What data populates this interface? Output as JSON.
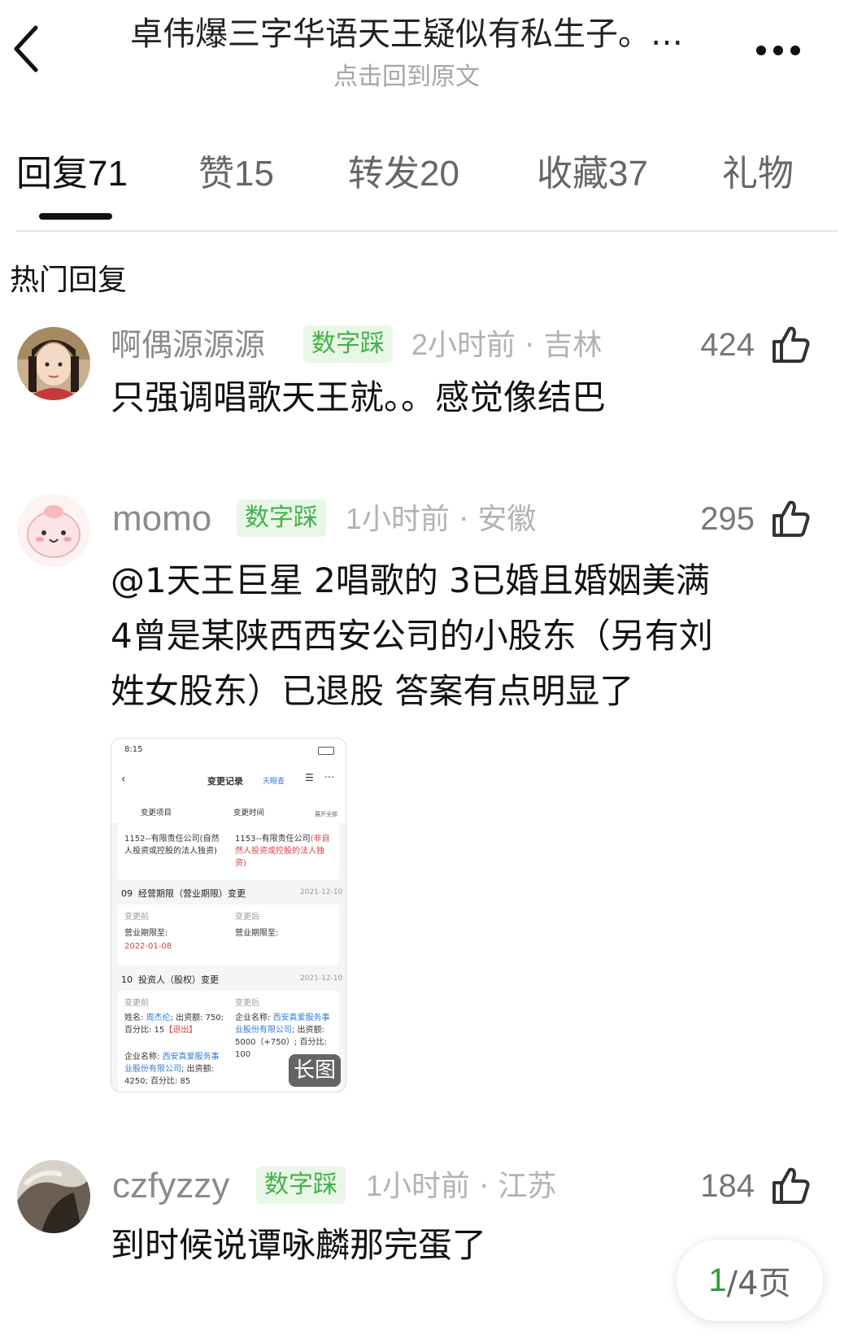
{
  "header": {
    "title": "卓伟爆三字华语天王疑似有私生子。…",
    "subtitle": "点击回到原文"
  },
  "tabs": [
    {
      "label": "回复",
      "count": "71"
    },
    {
      "label": "赞",
      "count": "15"
    },
    {
      "label": "转发",
      "count": "20"
    },
    {
      "label": "收藏",
      "count": "37"
    },
    {
      "label": "礼物",
      "count": ""
    }
  ],
  "section_title": "热门回复",
  "comments": [
    {
      "username": "啊偶源源源",
      "badge": "数字踩",
      "time": "2小时前",
      "location": "吉林",
      "likes": "424",
      "lines": [
        "只强调唱歌天王就。。感觉像结巴"
      ]
    },
    {
      "username": "momo",
      "badge": "数字踩",
      "time": "1小时前",
      "location": "安徽",
      "likes": "295",
      "lines": [
        "@1天王巨星 2唱歌的 3已婚且婚姻美满",
        "4曾是某陕西西安公司的小股东（另有刘",
        "姓女股东）已退股   答案有点明显了"
      ]
    },
    {
      "username": "czfyzzy",
      "badge": "数字踩",
      "time": "1小时前",
      "location": "江苏",
      "likes": "184",
      "lines": [
        "到时候说谭咏麟那完蛋了"
      ]
    }
  ],
  "image": {
    "status_time": "8:15",
    "nav_title": "变更记录",
    "brand": "天眼查",
    "filter_1": "变更项目",
    "filter_2": "变更时间",
    "expand_all": "展开全部",
    "r1_before": "1152--有限责任公司(自然人投资或控股的法人独资)",
    "r1_after_a": "1153--有限责任公司",
    "r1_after_b": "(非自然人投资或控股的法人独资)",
    "r2_index": "09",
    "r2_title": "经营期限（营业期限）变更",
    "r2_date": "2021-12-10",
    "label_before": "变更前",
    "label_after": "变更后",
    "r2_before": "营业期限至:",
    "r2_before_val": "2022-01-08",
    "r2_after": "营业期限至:",
    "r3_index": "10",
    "r3_title": "投资人（股权）变更",
    "r3_date": "2021-12-10",
    "r3_before_1": "姓名: ",
    "r3_before_name": "周杰伦",
    "r3_before_2": "; 出资额: 750; 百分比: 15",
    "r3_before_exit": "【退出】",
    "r3_before_3": "企业名称: ",
    "r3_before_co": "西安真爱服务事业股份有限公司",
    "r3_before_4": "; 出资额: 4250; 百分比: 85",
    "r3_after_1": "企业名称: ",
    "r3_after_co": "西安真爱服务事业股份有限公司",
    "r3_after_2": "; 出资额: 5000（+750）; 百分比: 100",
    "long_image": "长图"
  },
  "pager": {
    "current": "1",
    "total": "/4页"
  },
  "colors": {
    "badge_green": "#43b14a",
    "badge_bg": "#e9f7e6",
    "meta_gray": "#b2b2b2"
  }
}
